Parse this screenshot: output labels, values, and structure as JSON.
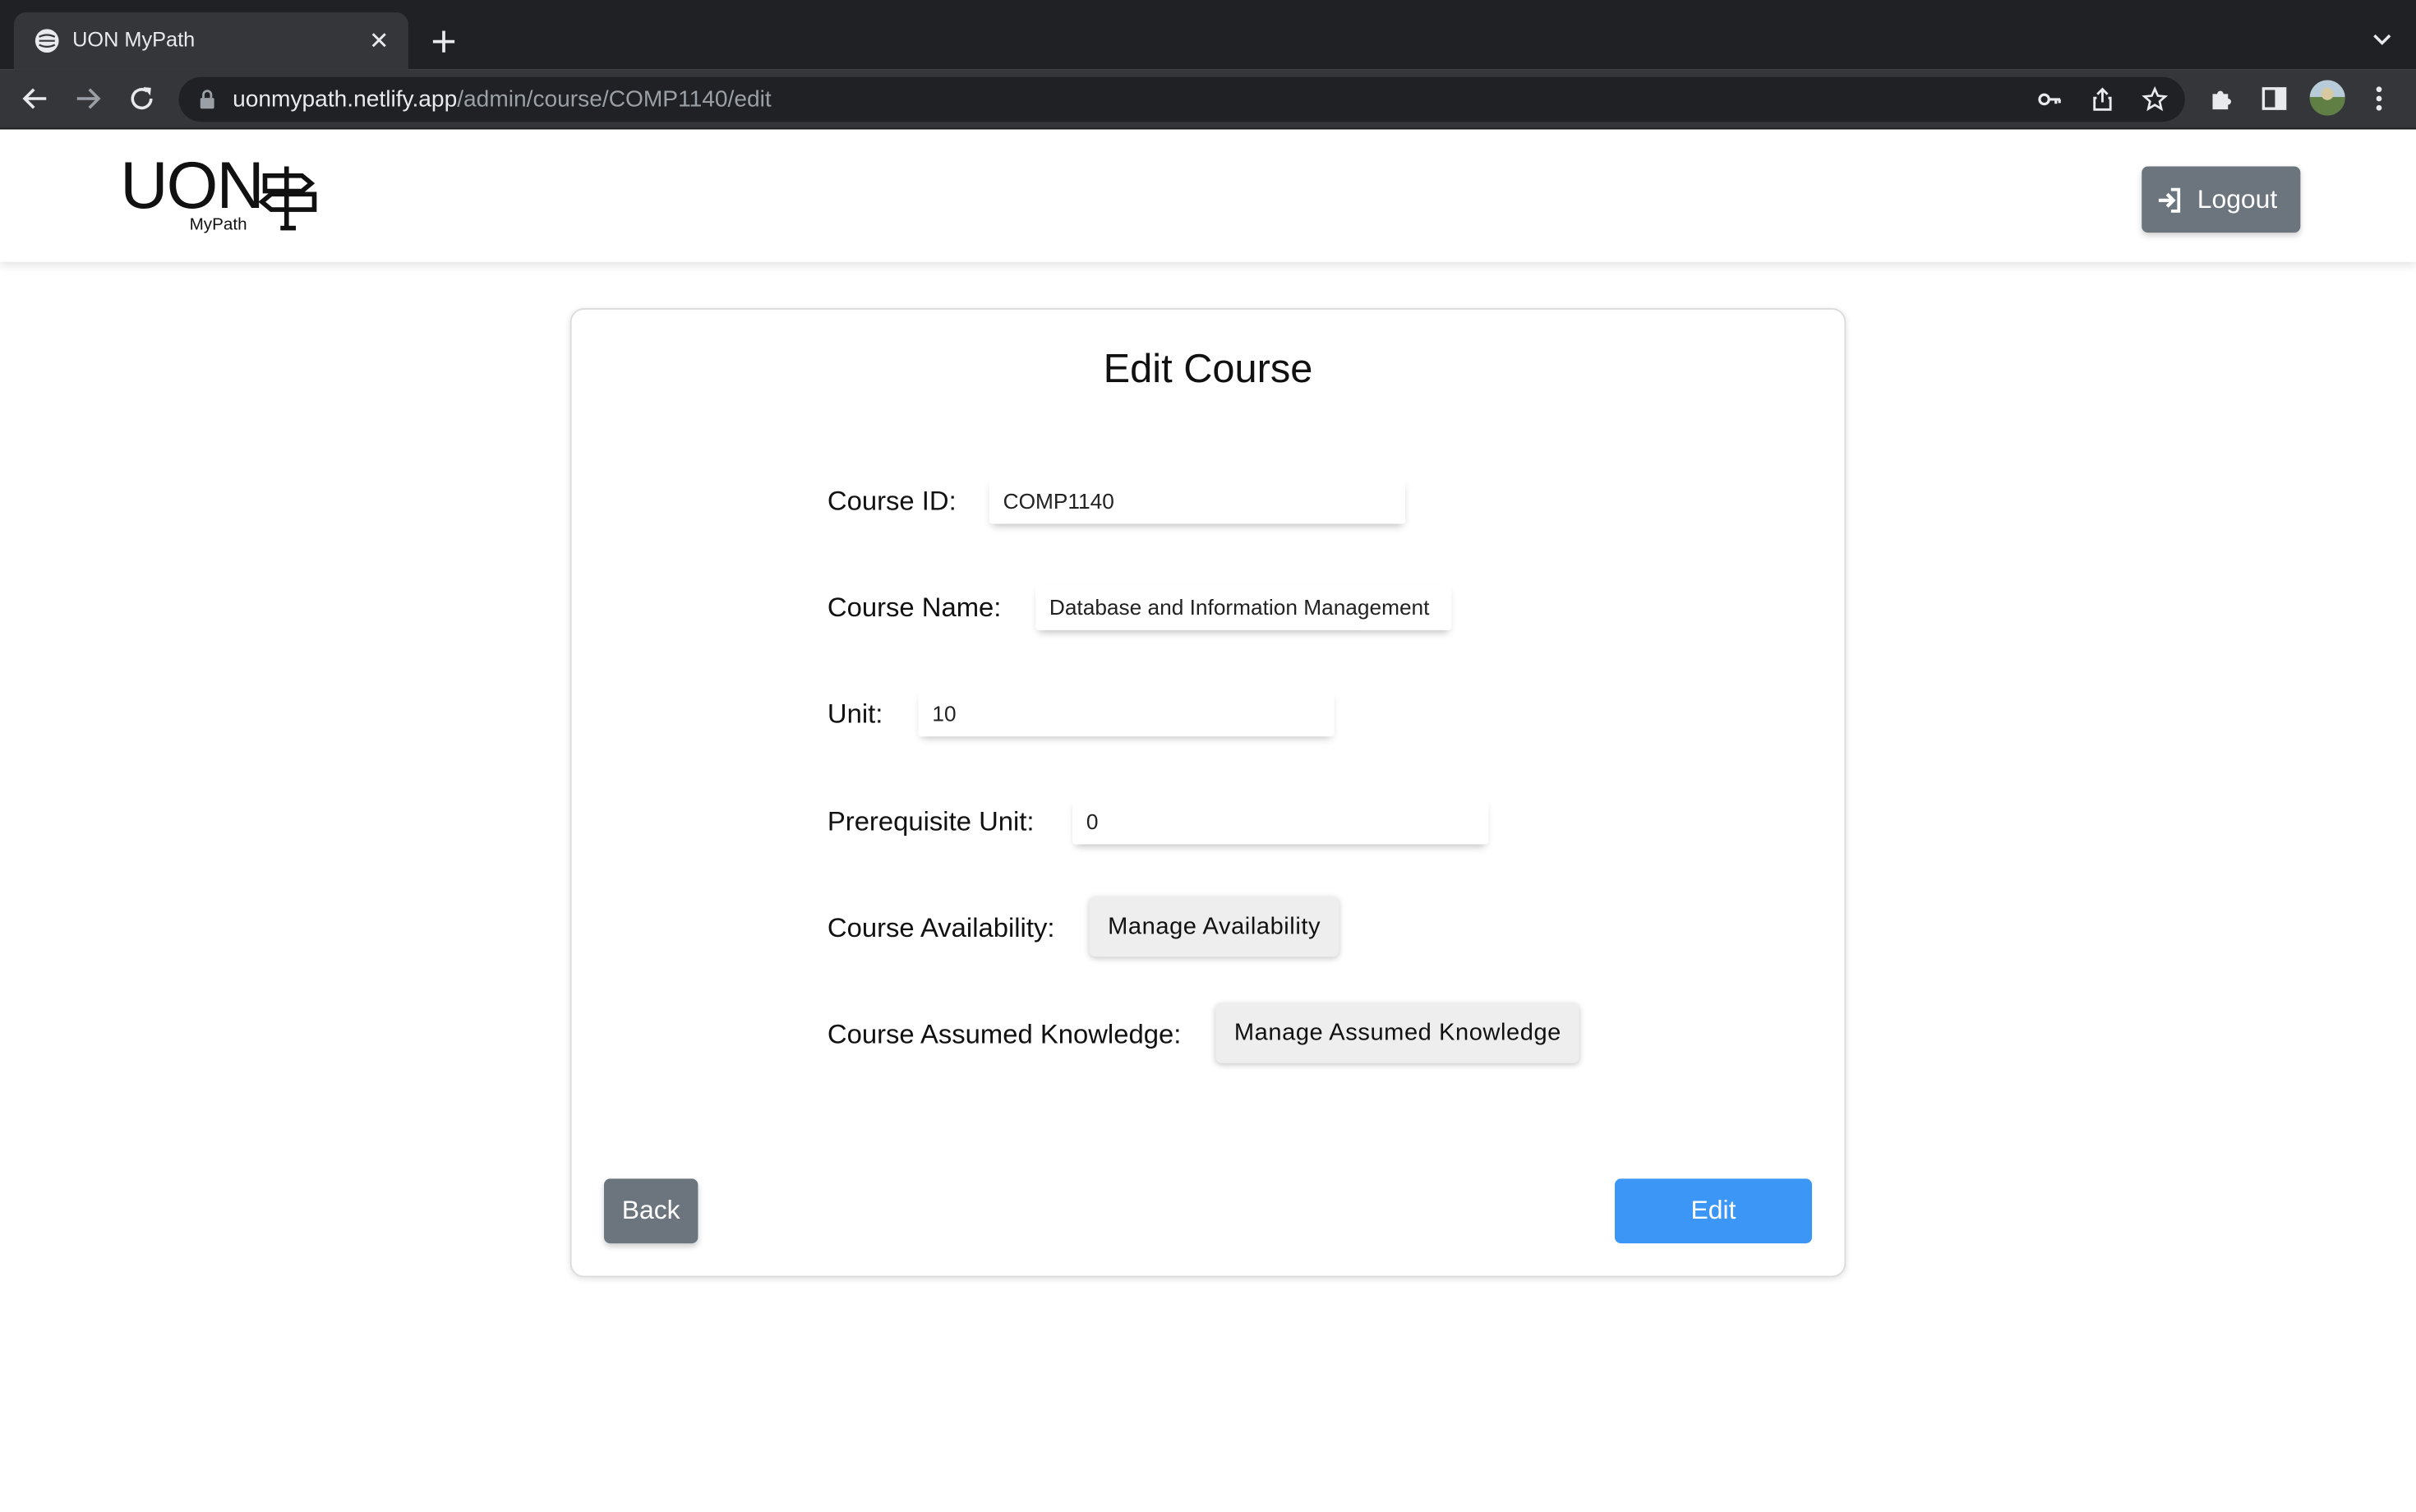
{
  "browser": {
    "tab_title": "UON MyPath",
    "url_host": "uonmypath.netlify.app",
    "url_path": "/admin/course/COMP1140/edit"
  },
  "header": {
    "logo_text": "UON",
    "logo_subtext": "MyPath",
    "logout_label": "Logout"
  },
  "form": {
    "title": "Edit Course",
    "course_id_label": "Course ID:",
    "course_id_value": "COMP1140",
    "course_name_label": "Course Name:",
    "course_name_value": "Database and Information Management",
    "unit_label": "Unit:",
    "unit_value": "10",
    "prereq_label": "Prerequisite Unit:",
    "prereq_value": "0",
    "availability_label": "Course Availability:",
    "availability_button": "Manage Availability",
    "assumed_label": "Course Assumed Knowledge:",
    "assumed_button": "Manage Assumed Knowledge",
    "back_button": "Back",
    "edit_button": "Edit"
  },
  "colors": {
    "primary": "#3b96f5",
    "secondary": "#6c757d"
  }
}
